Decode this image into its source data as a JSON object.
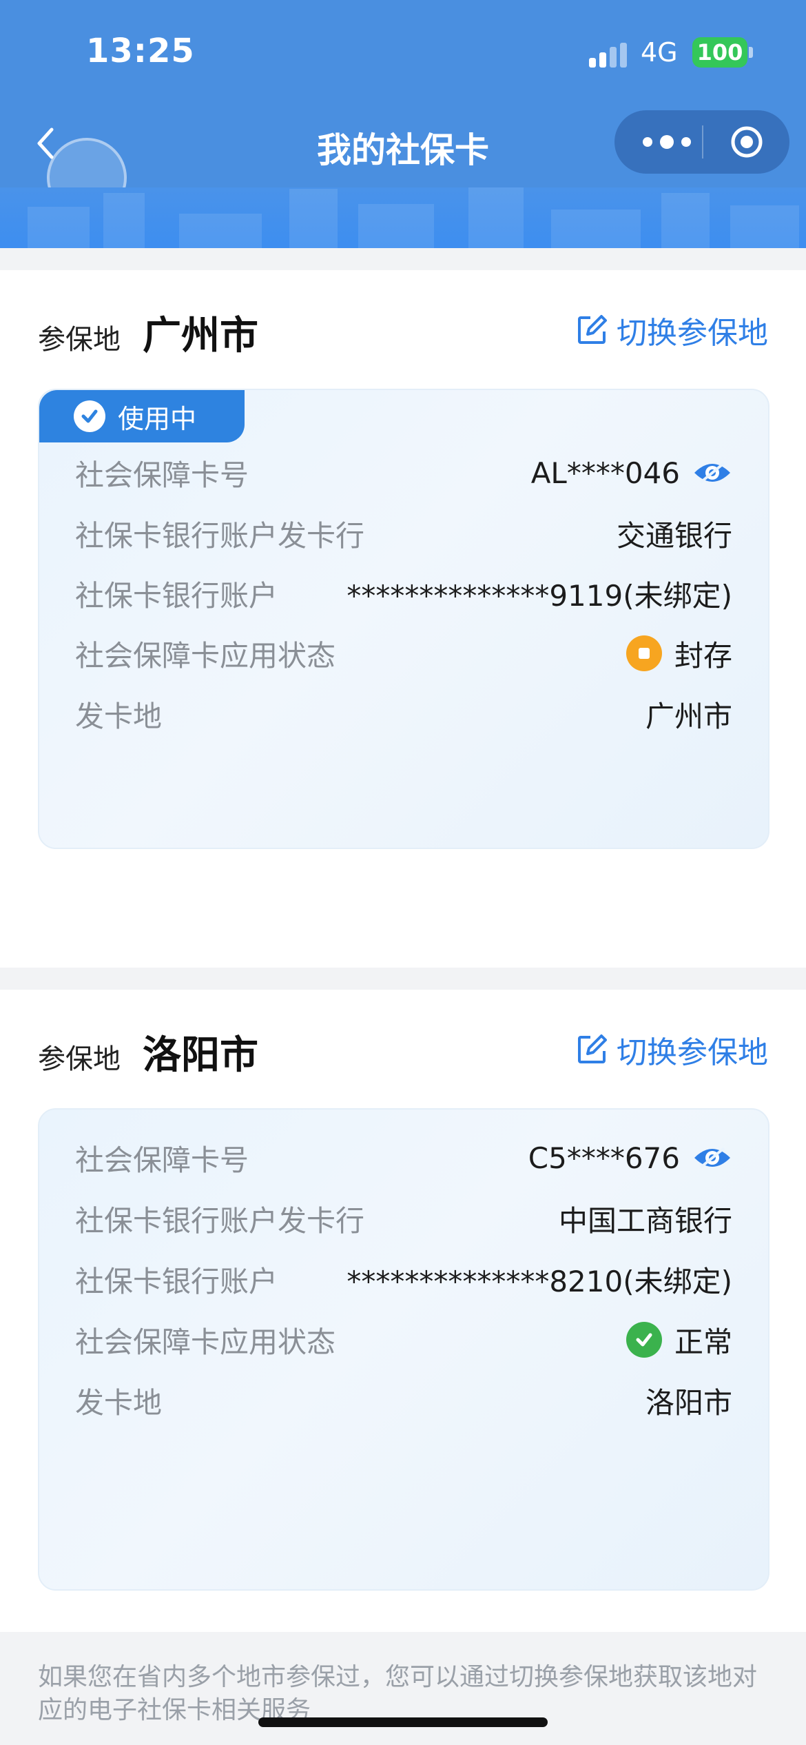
{
  "status_bar": {
    "time": "13:25",
    "network": "4G",
    "battery": "100"
  },
  "nav": {
    "title": "我的社保卡"
  },
  "sections": [
    {
      "label": "参保地",
      "city": "广州市",
      "switch": "切换参保地",
      "badge": "使用中",
      "rows": {
        "card_no_label": "社会保障卡号",
        "card_no": "AL****046",
        "bank_label": "社保卡银行账户发卡行",
        "bank": "交通银行",
        "account_label": "社保卡银行账户",
        "account": "**************9119(未绑定)",
        "status_label": "社会保障卡应用状态",
        "status": "封存",
        "issue_label": "发卡地",
        "issue": "广州市"
      }
    },
    {
      "label": "参保地",
      "city": "洛阳市",
      "switch": "切换参保地",
      "rows": {
        "card_no_label": "社会保障卡号",
        "card_no": "C5****676",
        "bank_label": "社保卡银行账户发卡行",
        "bank": "中国工商银行",
        "account_label": "社保卡银行账户",
        "account": "**************8210(未绑定)",
        "status_label": "社会保障卡应用状态",
        "status": "正常",
        "issue_label": "发卡地",
        "issue": "洛阳市"
      }
    }
  ],
  "footer": {
    "note": "如果您在省内多个地市参保过，您可以通过切换参保地获取该地对应的电子社保卡相关服务"
  },
  "colors": {
    "header": "#4a8fe0",
    "accent": "#2f7fe6",
    "sealed": "#f5a021",
    "normal": "#3bb24d"
  }
}
